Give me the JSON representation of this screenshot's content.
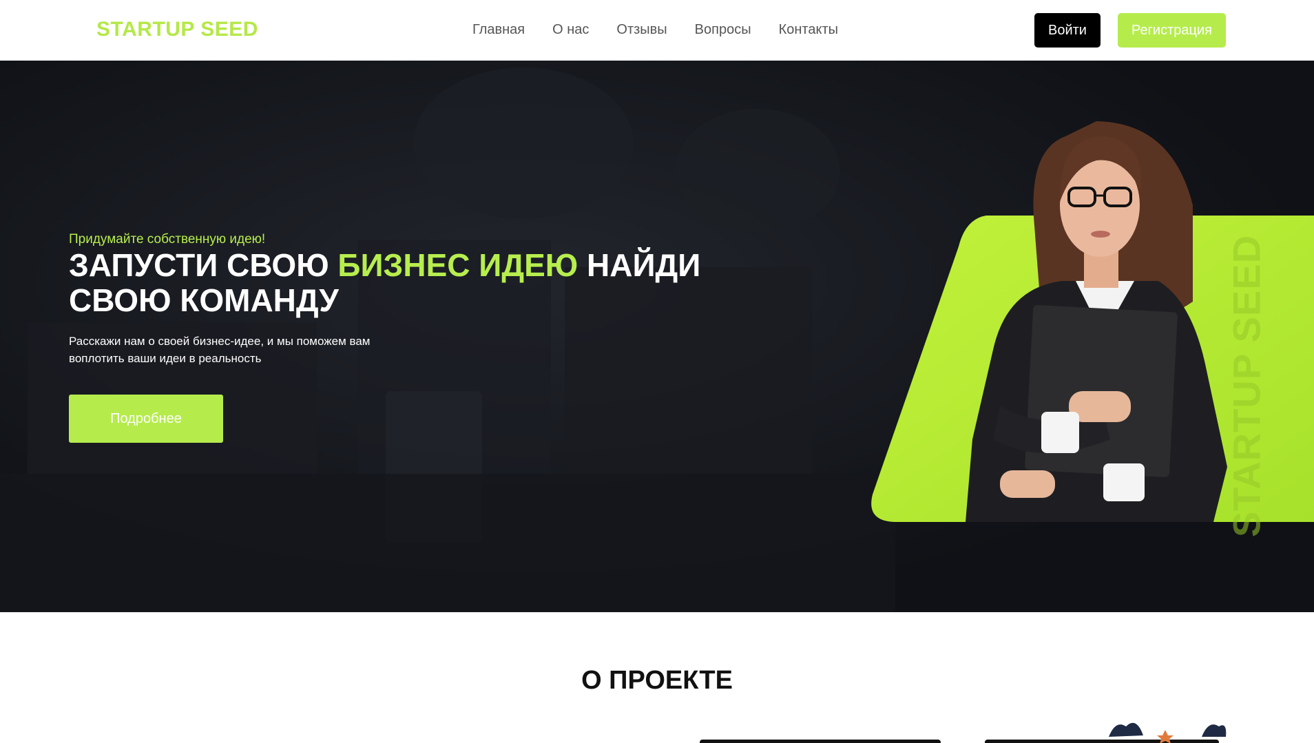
{
  "header": {
    "logo": "STARTUP SEED",
    "nav": [
      {
        "label": "Главная"
      },
      {
        "label": "О нас"
      },
      {
        "label": "Отзывы"
      },
      {
        "label": "Вопросы"
      },
      {
        "label": "Контакты"
      }
    ],
    "login_label": "Войти",
    "register_label": "Регистрация"
  },
  "hero": {
    "tagline": "Придумайте собственную идею!",
    "title_part1": "ЗАПУСТИ СВОЮ ",
    "title_accent": "БИЗНЕС ИДЕЮ",
    "title_part2": " НАЙДИ СВОЮ КОМАНДУ",
    "description": "Расскажи нам о своей бизнес-идее, и мы поможем вам воплотить ваши идеи в реальность",
    "button_label": "Подробнее",
    "side_brand": "STARTUP SEED"
  },
  "about": {
    "title": "О ПРОЕКТЕ"
  },
  "colors": {
    "accent": "#b7ee4e",
    "dark": "#12141a",
    "login_bg": "#000000"
  }
}
